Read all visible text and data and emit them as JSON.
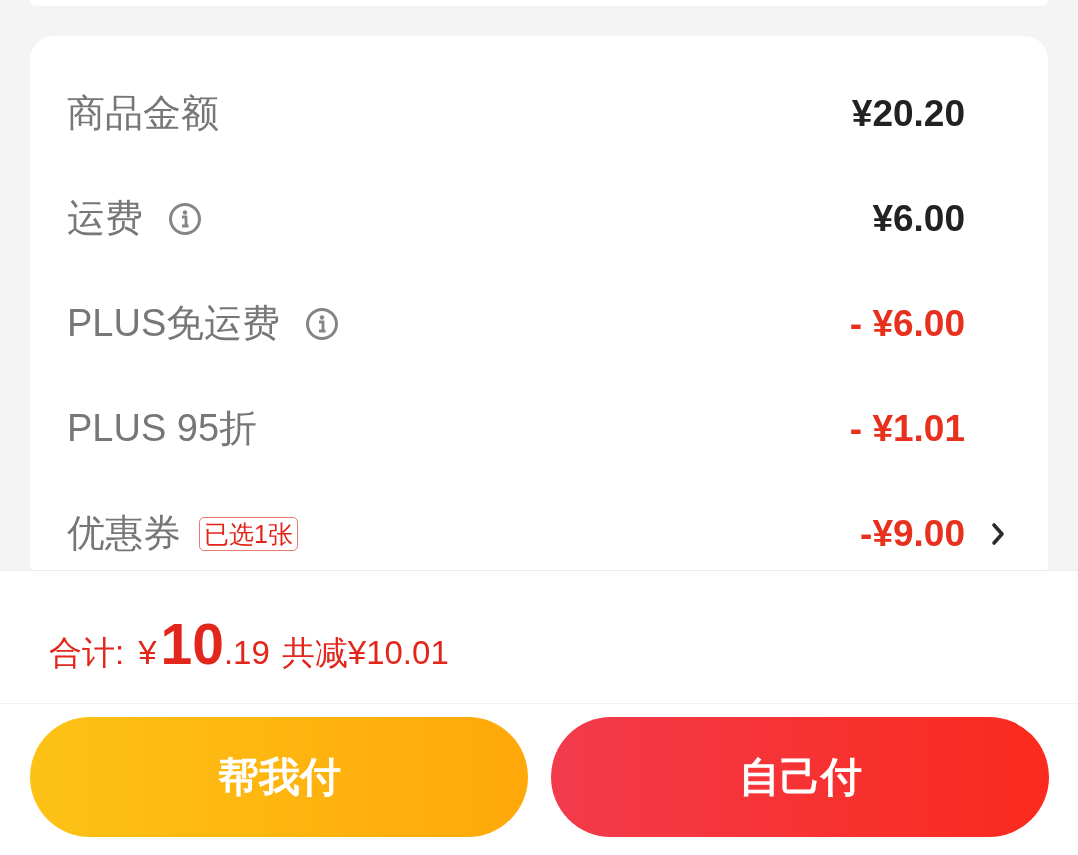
{
  "amounts": [
    {
      "label": "商品金额",
      "value": "¥20.20",
      "kind": "charge",
      "info": false,
      "chevron": false
    },
    {
      "label": "运费",
      "value": "¥6.00",
      "kind": "charge",
      "info": true,
      "chevron": false
    },
    {
      "label": "PLUS免运费",
      "value": "- ¥6.00",
      "kind": "discount",
      "info": true,
      "chevron": false
    },
    {
      "label": "PLUS 95折",
      "value": "- ¥1.01",
      "kind": "discount",
      "info": false,
      "chevron": false
    },
    {
      "label": "优惠券",
      "badge": "已选1张",
      "value": "-¥9.00",
      "kind": "discount",
      "info": false,
      "chevron": true
    }
  ],
  "total": {
    "label": "合计:",
    "currency": "¥",
    "integer": "10",
    "decimal": ".19",
    "savings": "共减¥10.01"
  },
  "buttons": [
    {
      "label": "帮我付",
      "kind": "secondary"
    },
    {
      "label": "自己付",
      "kind": "primary"
    }
  ]
}
